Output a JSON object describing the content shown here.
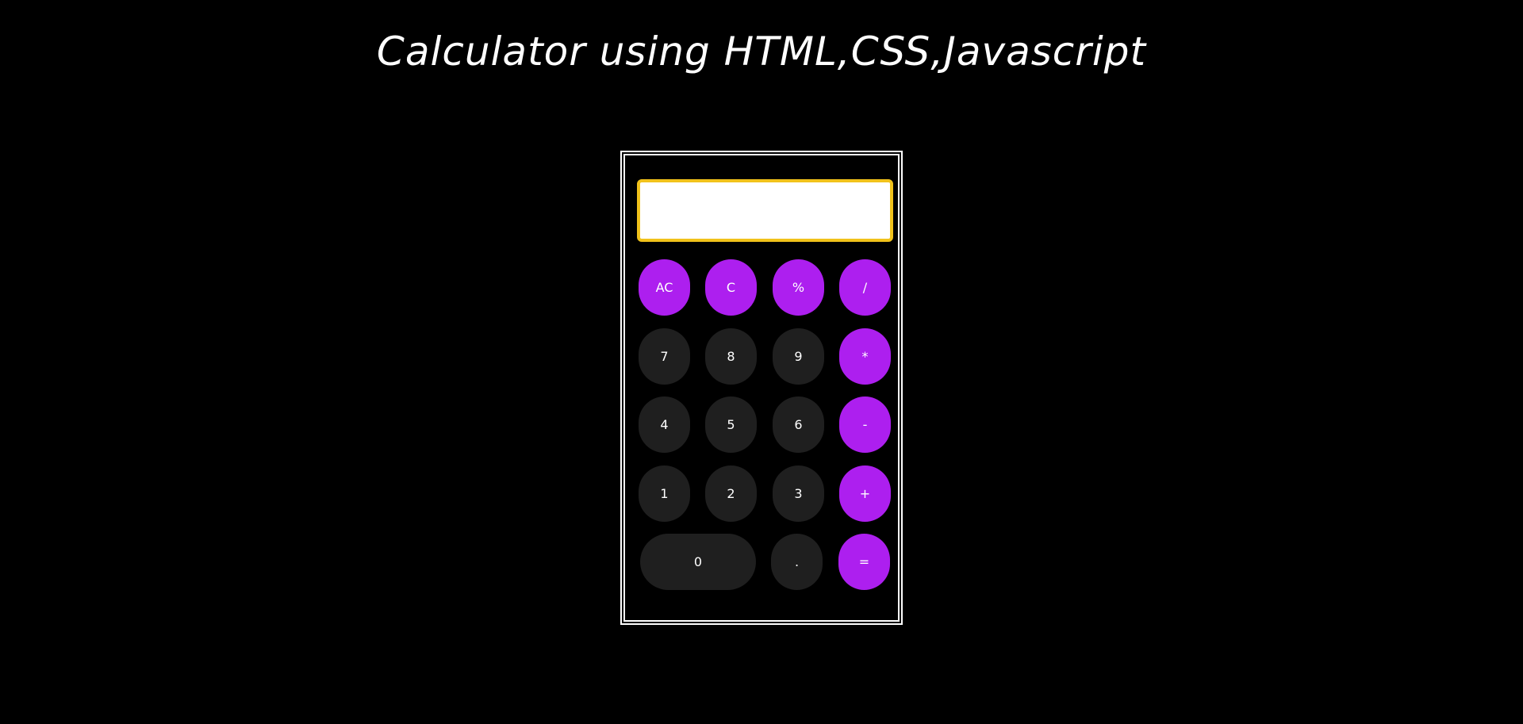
{
  "title": "Calculator using HTML,CSS,Javascript",
  "display": {
    "value": ""
  },
  "colors": {
    "background": "#000000",
    "operator": "#ad1fef",
    "number": "#1f1f1f",
    "display_border": "#f1c21b"
  },
  "buttons": {
    "ac": "AC",
    "c": "C",
    "percent": "%",
    "divide": "/",
    "seven": "7",
    "eight": "8",
    "nine": "9",
    "multiply": "*",
    "four": "4",
    "five": "5",
    "six": "6",
    "minus": "-",
    "one": "1",
    "two": "2",
    "three": "3",
    "plus": "+",
    "zero": "0",
    "dot": ".",
    "equals": "="
  }
}
